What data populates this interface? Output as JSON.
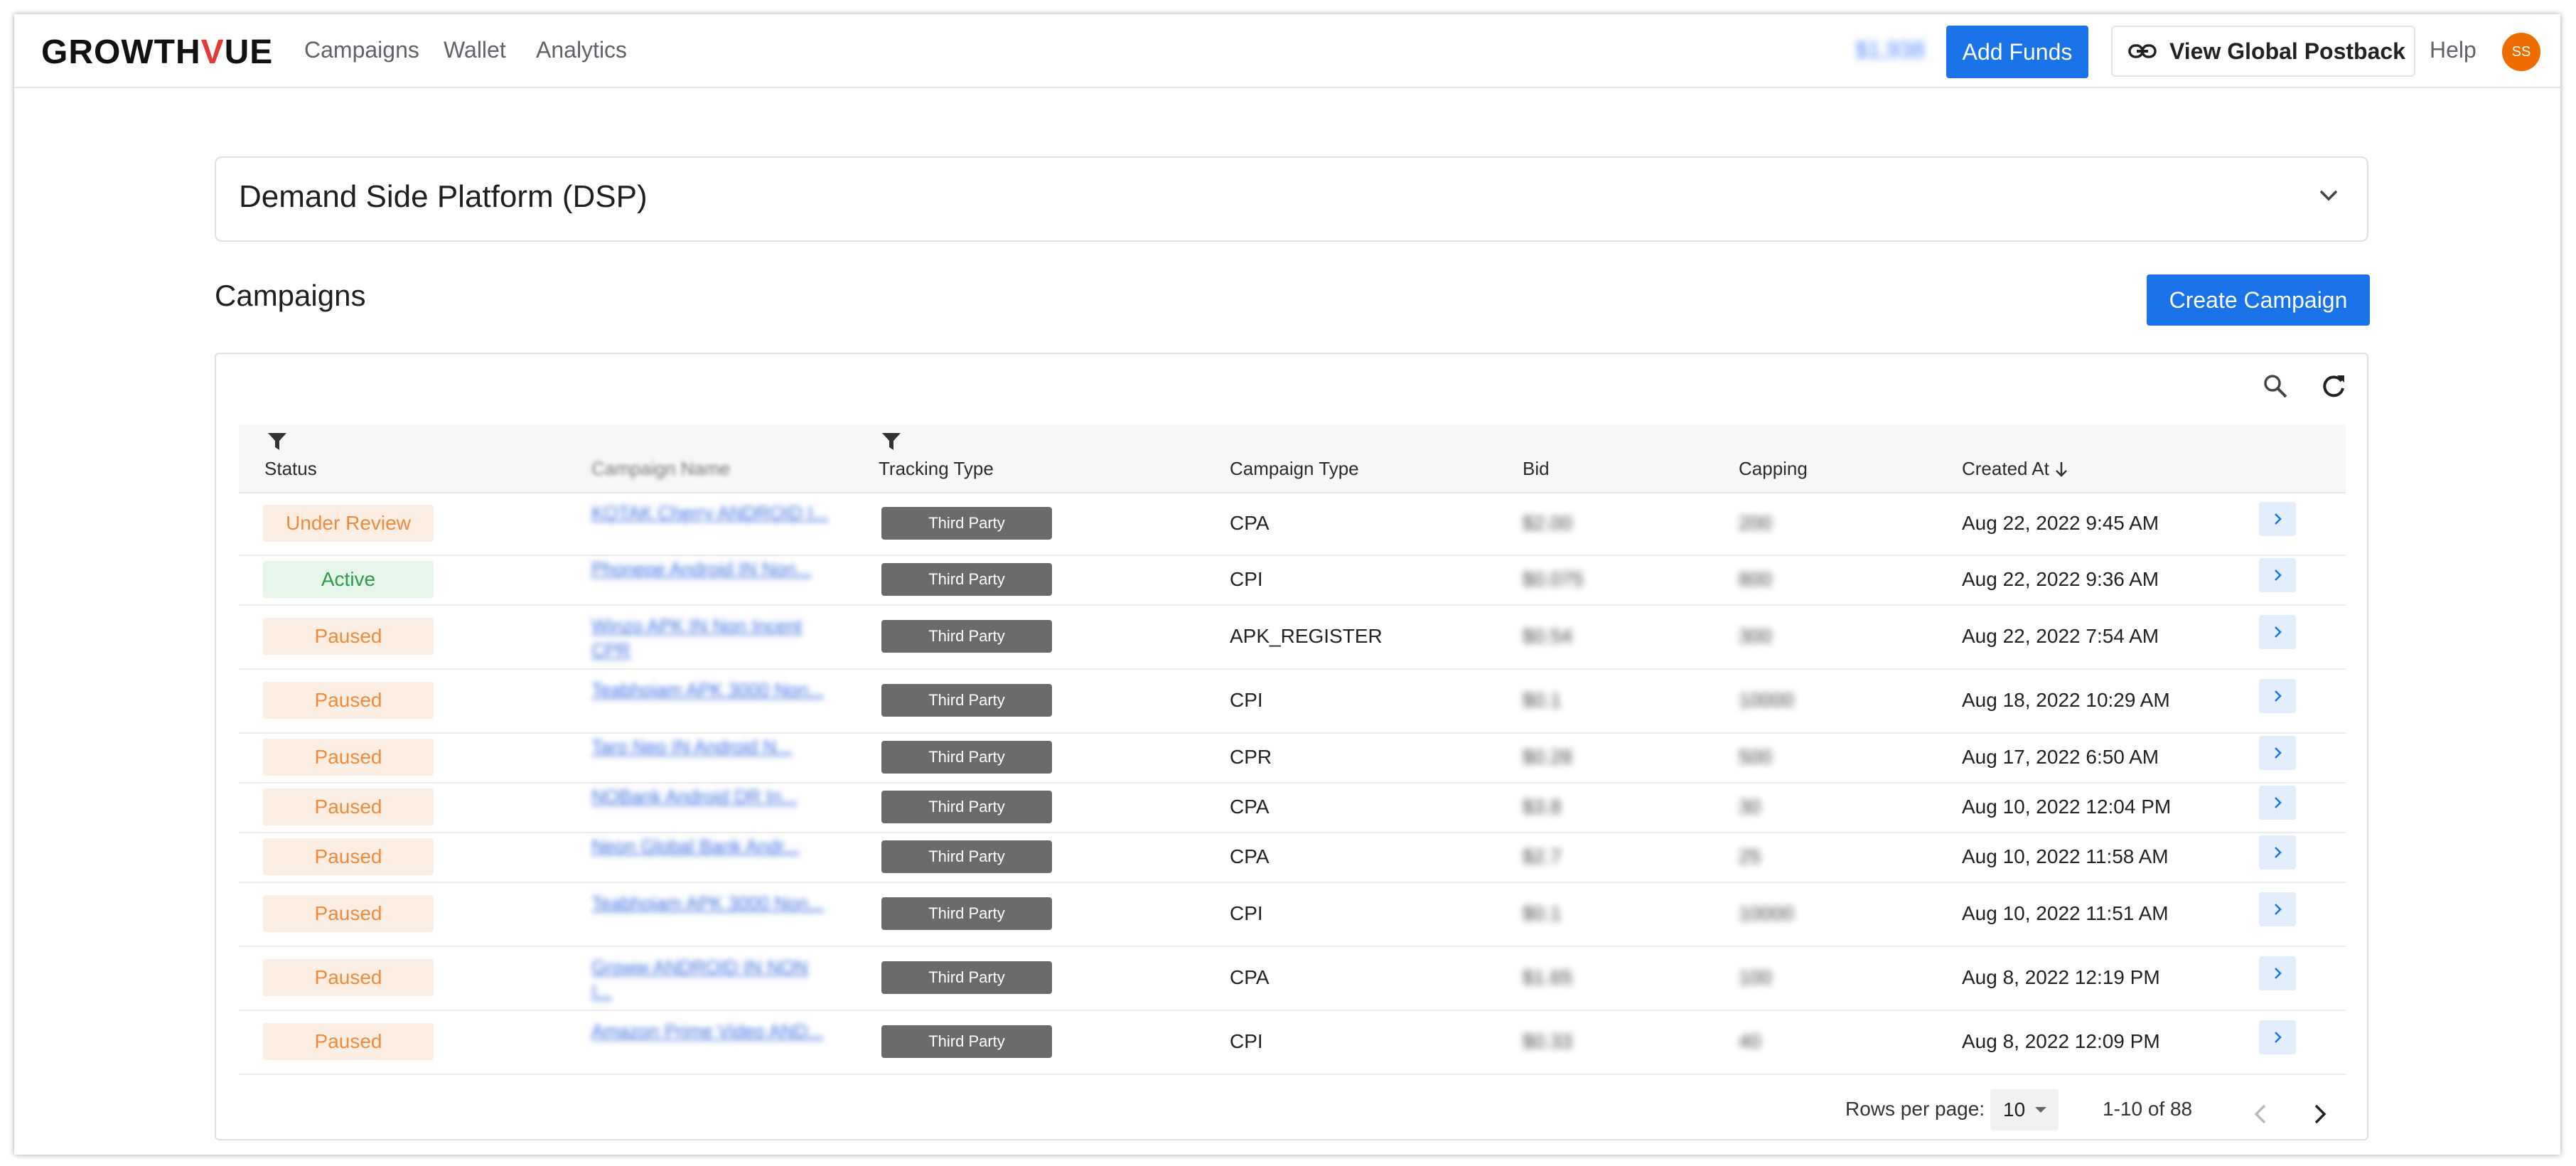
{
  "nav": {
    "logo_pre": "GROWTH",
    "logo_v": "V",
    "logo_post": "UE",
    "links": [
      "Campaigns",
      "Wallet",
      "Analytics"
    ],
    "balance": "$1,938",
    "add_funds": "Add Funds",
    "postback": "View Global Postback",
    "help": "Help",
    "avatar": "SS"
  },
  "dsp": {
    "title": "Demand Side Platform (DSP)"
  },
  "campaigns": {
    "title": "Campaigns",
    "create_label": "Create Campaign",
    "columns": {
      "status": "Status",
      "name": "Campaign Name",
      "tracking": "Tracking Type",
      "type": "Campaign Type",
      "bid": "Bid",
      "capping": "Capping",
      "created": "Created At"
    },
    "rows": [
      {
        "status": "Under Review",
        "name": "KOTAK Cherry ANDROID I...",
        "tracking": "Third Party",
        "type": "CPA",
        "bid": "$2.00",
        "capping": "200",
        "created": "Aug 22, 2022 9:45 AM"
      },
      {
        "status": "Active",
        "name": "Phonepe Android IN Non...",
        "tracking": "Third Party",
        "type": "CPI",
        "bid": "$0.075",
        "capping": "800",
        "created": "Aug 22, 2022 9:36 AM"
      },
      {
        "status": "Paused",
        "name": "Winzo APK IN Non Incent CPR",
        "tracking": "Third Party",
        "type": "APK_REGISTER",
        "bid": "$0.54",
        "capping": "300",
        "created": "Aug 22, 2022 7:54 AM"
      },
      {
        "status": "Paused",
        "name": "Teabhojam APK 3000 Non...",
        "tracking": "Third Party",
        "type": "CPI",
        "bid": "$0.1",
        "capping": "10000",
        "created": "Aug 18, 2022 10:29 AM"
      },
      {
        "status": "Paused",
        "name": "Taro Neo IN Android N...",
        "tracking": "Third Party",
        "type": "CPR",
        "bid": "$0.28",
        "capping": "500",
        "created": "Aug 17, 2022 6:50 AM"
      },
      {
        "status": "Paused",
        "name": "NOBank Android DR In...",
        "tracking": "Third Party",
        "type": "CPA",
        "bid": "$3.8",
        "capping": "30",
        "created": "Aug 10, 2022 12:04 PM"
      },
      {
        "status": "Paused",
        "name": "Neon Global Bank Andr...",
        "tracking": "Third Party",
        "type": "CPA",
        "bid": "$2.7",
        "capping": "25",
        "created": "Aug 10, 2022 11:58 AM"
      },
      {
        "status": "Paused",
        "name": "Teabhojam APK 3000 Non...",
        "tracking": "Third Party",
        "type": "CPI",
        "bid": "$0.1",
        "capping": "10000",
        "created": "Aug 10, 2022 11:51 AM"
      },
      {
        "status": "Paused",
        "name": "Groww ANDROID IN NON I...",
        "tracking": "Third Party",
        "type": "CPA",
        "bid": "$1.65",
        "capping": "100",
        "created": "Aug 8, 2022 12:19 PM"
      },
      {
        "status": "Paused",
        "name": "Amazon Prime Video AND...",
        "tracking": "Third Party",
        "type": "CPI",
        "bid": "$0.33",
        "capping": "40",
        "created": "Aug 8, 2022 12:09 PM"
      }
    ],
    "pagination": {
      "rows_label": "Rows per page:",
      "rows_value": "10",
      "range": "1-10 of 88"
    }
  },
  "colors": {
    "primary": "#1a73e8",
    "paused_bg": "#fdeee4",
    "paused_fg": "#f08a3c",
    "active_bg": "#e7f6ea",
    "active_fg": "#2e9b45",
    "tracking_bg": "#6b6b6b",
    "avatar_bg": "#ef6c00"
  },
  "icons": [
    "link-icon",
    "chevron-down-icon",
    "search-icon",
    "refresh-icon",
    "filter-icon",
    "sort-down-icon",
    "chevron-right-icon",
    "chevron-left-icon",
    "caret-down-icon"
  ]
}
